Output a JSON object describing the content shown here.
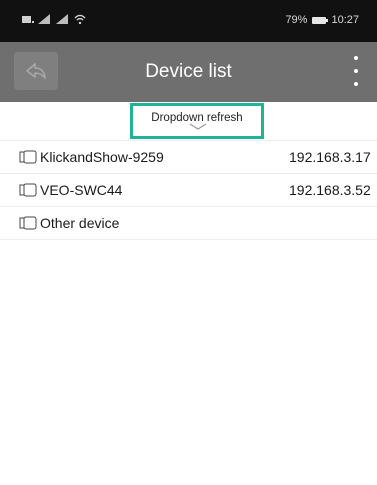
{
  "status_bar": {
    "left_icons": [
      "notification-icon",
      "signal-icon",
      "signal-icon",
      "wifi-icon"
    ],
    "battery_text": "79%",
    "time": "10:27"
  },
  "toolbar": {
    "title": "Device list",
    "back_icon": "back-arrow-icon",
    "menu_icon": "more-vert-icon"
  },
  "refresh": {
    "label": "Dropdown refresh",
    "highlight_color": "#1fb39a"
  },
  "devices": [
    {
      "name": "KlickandShow-9259",
      "ip": "192.168.3.17"
    },
    {
      "name": "VEO-SWC44",
      "ip": "192.168.3.52"
    },
    {
      "name": "Other device",
      "ip": ""
    }
  ],
  "colors": {
    "toolbar": "#6f6f6f",
    "status_bar": "#111111"
  }
}
